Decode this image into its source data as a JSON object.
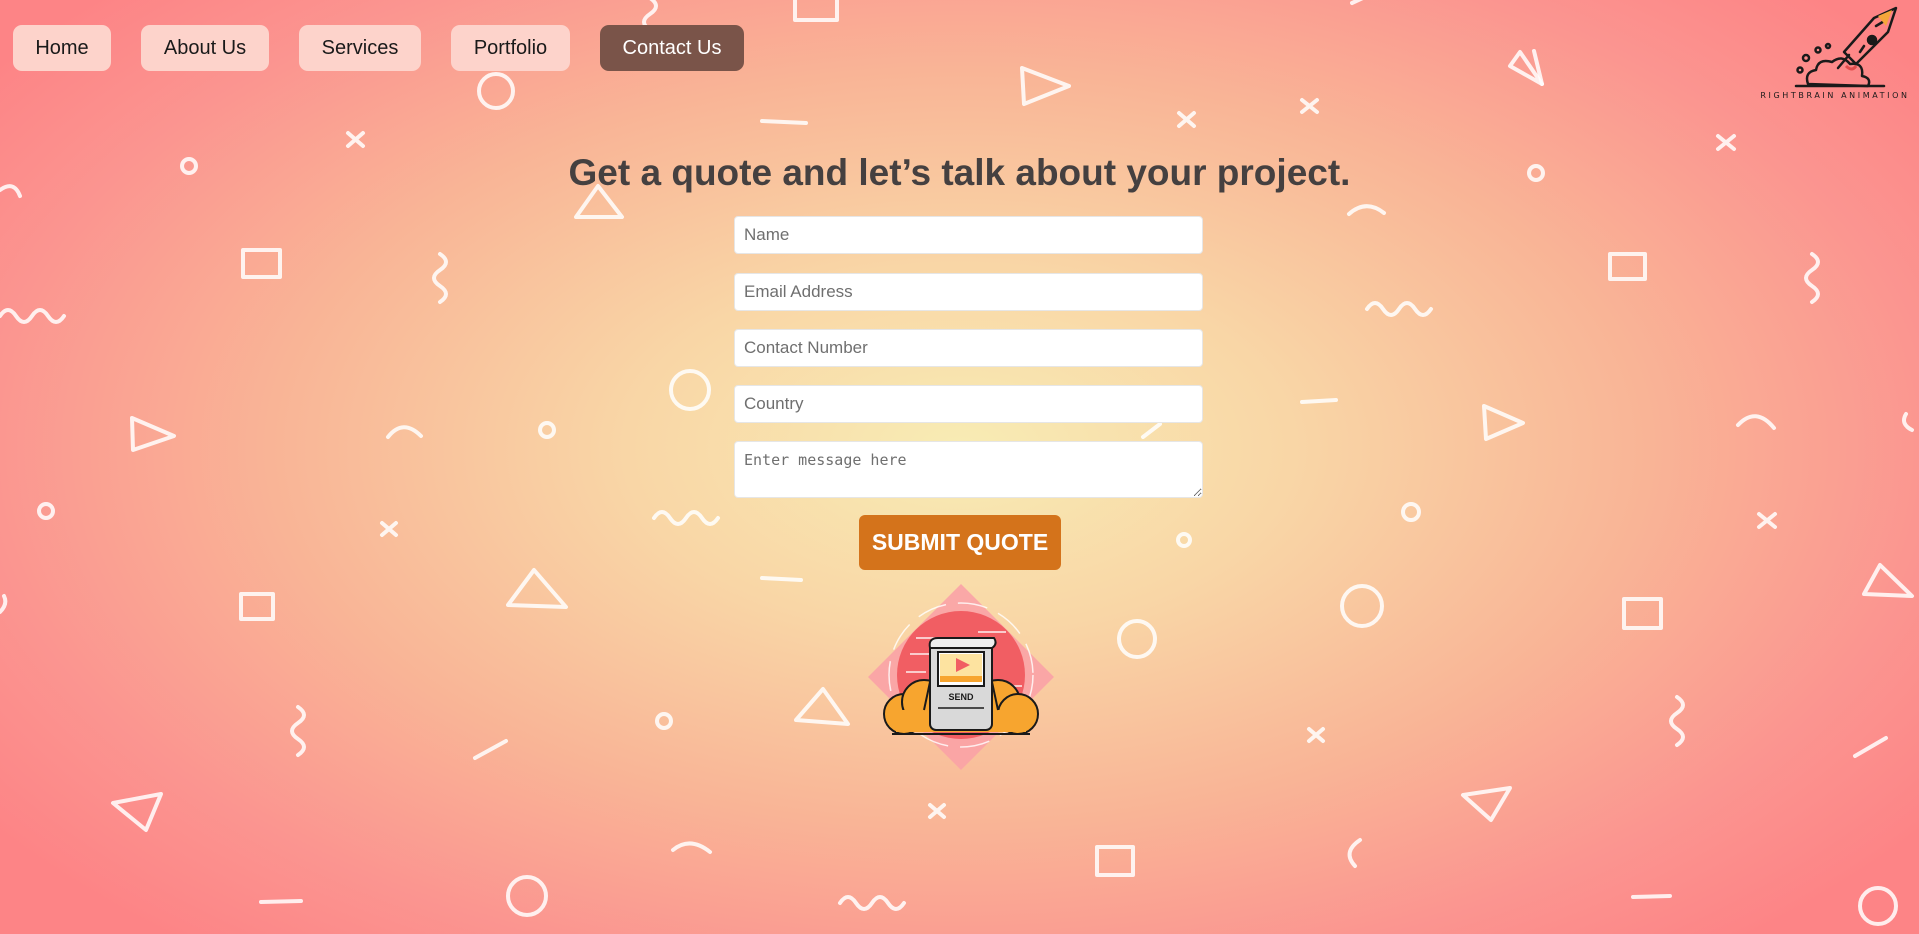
{
  "nav": {
    "items": [
      {
        "label": "Home",
        "active": false
      },
      {
        "label": "About Us",
        "active": false
      },
      {
        "label": "Services",
        "active": false
      },
      {
        "label": "Portfolio",
        "active": false
      },
      {
        "label": "Contact Us",
        "active": true
      }
    ]
  },
  "logo": {
    "text": "RIGHTBRAIN ANIMATION",
    "icon": "rocket-icon"
  },
  "heading": "Get a quote and let’s talk about your project.",
  "form": {
    "name_placeholder": "Name",
    "email_placeholder": "Email Address",
    "phone_placeholder": "Contact Number",
    "country_placeholder": "Country",
    "message_placeholder": "Enter message here",
    "submit_label": "SUBMIT QUOTE"
  },
  "illustration": {
    "label": "SEND",
    "icon": "send-cloud-icon"
  },
  "colors": {
    "accent": "#d4731b",
    "active_nav": "#7a5449",
    "nav_bg": "#fdd3cb",
    "heading": "#454040"
  }
}
